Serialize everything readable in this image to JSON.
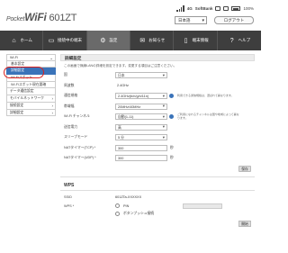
{
  "header": {
    "logo_pocket": "Pocket",
    "logo_wifi": "WiFi",
    "logo_model": "601ZT",
    "status": {
      "lte": "4G",
      "carrier": "SoftBank",
      "battery_percent": "100%"
    },
    "language": "日本語",
    "logout_label": "ログアウト"
  },
  "nav": {
    "items": [
      {
        "label": "ホーム",
        "icon": "home-icon"
      },
      {
        "label": "接続中の端末",
        "icon": "devices-icon"
      },
      {
        "label": "設定",
        "icon": "gear-icon"
      },
      {
        "label": "お知らせ",
        "icon": "envelope-icon"
      },
      {
        "label": "端末情報",
        "icon": "device-info-icon"
      },
      {
        "label": "ヘルプ",
        "icon": "help-icon"
      }
    ],
    "active_index": 2
  },
  "sidebar": {
    "items": [
      {
        "label": "Wi-Fi",
        "chev": "⌄"
      },
      {
        "label": "基本設定",
        "chev": ""
      },
      {
        "label": "詳細設定",
        "chev": ""
      },
      {
        "label": "Wi-Fiスポット",
        "chev": ""
      },
      {
        "label": "Wi-Fiスポット現在要確",
        "chev": ""
      },
      {
        "label": "データ通信設定",
        "chev": ""
      },
      {
        "label": "モバイルネットワーク",
        "chev": "›"
      },
      {
        "label": "接続設定",
        "chev": "›"
      },
      {
        "label": "詳細設定",
        "chev": "›"
      }
    ],
    "selected_index": 2
  },
  "main": {
    "title": "詳細設定",
    "intro": "この画面で無線LANの詳細を設定できます。変更する項目はご注意ください。",
    "fields": [
      {
        "label": "国",
        "value": "日本",
        "type": "select",
        "hint": ""
      },
      {
        "label": "周波数",
        "value": "2.4GHz",
        "type": "text",
        "hint": ""
      },
      {
        "label": "通信規格",
        "value": "2.4GHz(b/n/g/n/11n)",
        "type": "select",
        "hint": "利用できる通信規格は、選ばれて異なります。"
      },
      {
        "label": "帯域幅",
        "value": "20MHz/40MHz",
        "type": "select",
        "hint": ""
      },
      {
        "label": "Wi-Fi チャンネル",
        "value": "自動(1-11)",
        "type": "select",
        "hint": "ご利用になれるチャンネルは国や地域によって異なります。"
      },
      {
        "label": "送信電力",
        "value": "高",
        "type": "select",
        "hint": ""
      },
      {
        "label": "スリープモード",
        "value": "5 分",
        "type": "select",
        "hint": ""
      },
      {
        "label": "NATタイマー(TCP) *",
        "value": "300",
        "type": "input",
        "hint": "",
        "unit": "秒"
      },
      {
        "label": "NATタイマー(UDP) *",
        "value": "300",
        "type": "input",
        "hint": "",
        "unit": "秒"
      }
    ],
    "save_label": "保存"
  },
  "wps": {
    "title": "WPS",
    "ssid_label": "SSID",
    "ssid_value": "601ZTa-XXXXXX",
    "wps_label": "WPS *",
    "pin_label": "PIN",
    "push_label": "ボタンプッシュ接続",
    "start_label": "開始"
  }
}
